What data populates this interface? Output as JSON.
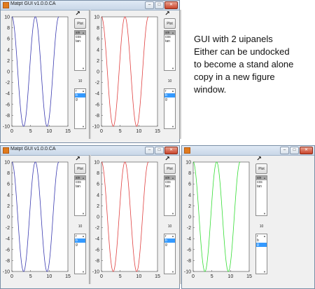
{
  "windows": [
    {
      "title": "Matpt GUI v1.0.0.CA",
      "panels": [
        {
          "color": "#3a3ab0",
          "plot_label": "Plot",
          "functions": [
            "sin",
            "cos",
            "tan"
          ],
          "number": "10",
          "colors": [
            "r",
            "b",
            "g"
          ],
          "selected_color_index": 1
        },
        {
          "color": "#e04040",
          "plot_label": "Plot",
          "functions": [
            "sin",
            "cos",
            "tan"
          ],
          "number": "10",
          "colors": [
            "r",
            "b",
            "g"
          ],
          "selected_color_index": 1
        }
      ]
    },
    {
      "title": "Matpt GUI v1.0.0.CA",
      "panels": [
        {
          "color": "#3a3ab0",
          "plot_label": "Plot",
          "functions": [
            "sin",
            "cos",
            "tan"
          ],
          "number": "10",
          "colors": [
            "r",
            "b",
            "g"
          ],
          "selected_color_index": 1
        },
        {
          "color": "#e04040",
          "plot_label": "Plot",
          "functions": [
            "sin",
            "cos",
            "tan"
          ],
          "number": "10",
          "colors": [
            "r",
            "b",
            "g"
          ],
          "selected_color_index": 1
        }
      ]
    },
    {
      "title": "",
      "panels": [
        {
          "color": "#33dd33",
          "plot_label": "Plot",
          "functions": [
            "sin",
            "cos",
            "tan"
          ],
          "number": "10",
          "colors": [
            "r",
            "b",
            "g"
          ],
          "selected_color_index": 2
        }
      ]
    }
  ],
  "annotation": [
    "GUI with 2 uipanels",
    "Either can be undocked",
    "to become a stand alone",
    "copy in a new figure",
    "window."
  ],
  "axes": {
    "y_ticks": [
      "10",
      "8",
      "6",
      "4",
      "2",
      "0",
      "-2",
      "-4",
      "-6",
      "-8",
      "-10"
    ],
    "x_ticks": [
      "0",
      "5",
      "10",
      "15"
    ]
  },
  "icons": {
    "undock": "undock-arrow-icon",
    "window": "matlab-figure-icon"
  }
}
